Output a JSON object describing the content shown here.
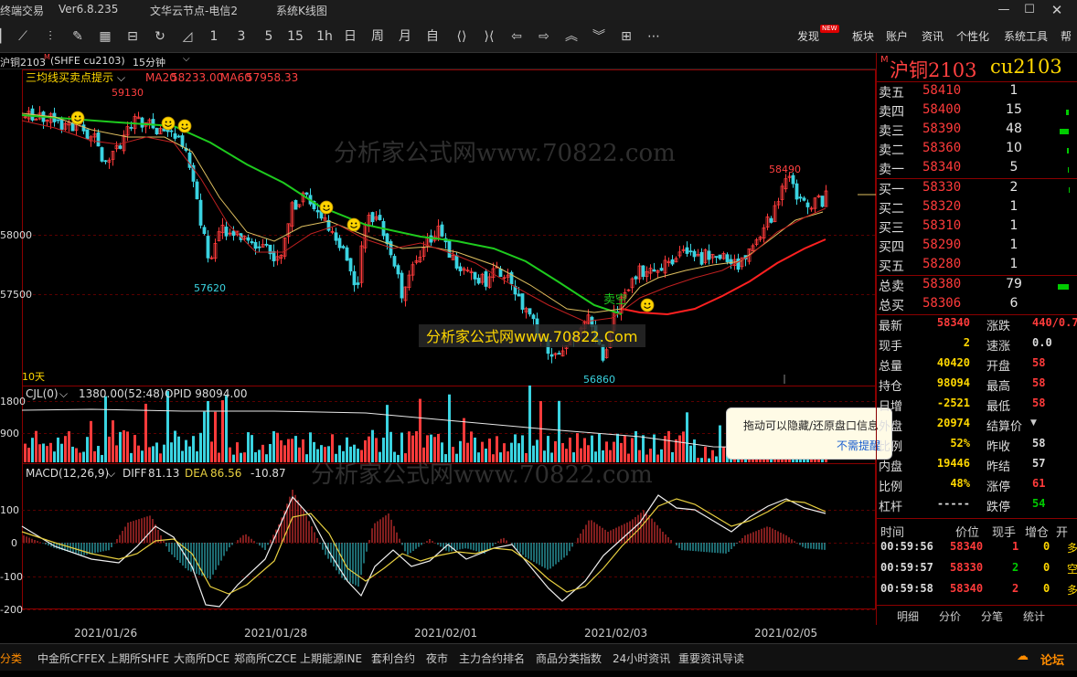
{
  "titlebar": {
    "app": "终端交易",
    "version": "Ver6.8.235",
    "server": "文华云节点-电信2",
    "mode": "系统K线图"
  },
  "toolbar": {
    "period_buttons": [
      "1",
      "3",
      "5",
      "15",
      "1h",
      "日",
      "周",
      "月",
      "自"
    ],
    "right": {
      "discover": "发现",
      "badge": "NEW",
      "sector": "板块",
      "account": "账户",
      "news": "资讯",
      "personal": "个性化",
      "tools": "系统工具",
      "more": "帮"
    }
  },
  "instrument": {
    "name": "沪铜2103",
    "mark": "M",
    "paren": "(SHFE cu2103)",
    "period": "15分钟"
  },
  "main": {
    "indicator": "三均线买卖点提示",
    "ma20_label": "MA20",
    "ma20": "58233.00",
    "ma60_label": "MA60",
    "ma60": "57958.33",
    "labels": {
      "h1": "59130",
      "h2": "58490",
      "l1": "57620",
      "l2": "56860",
      "sell": "卖空",
      "days": "10天"
    },
    "yticks": [
      "58000",
      "57500"
    ]
  },
  "volume": {
    "title": "CJL(0)",
    "value": "1380.00(52:48)",
    "opid": "OPID 98094.00",
    "yticks": [
      "1800",
      "900"
    ]
  },
  "macd": {
    "title": "MACD(12,26,9)",
    "diff_label": "DIFF",
    "diff": "81.13",
    "dea_label": "DEA",
    "dea": "86.56",
    "macd": "-10.87",
    "yticks": [
      "100",
      "0",
      "-100",
      "-200"
    ]
  },
  "dates": [
    "2021/01/26",
    "2021/01/28",
    "2021/02/01",
    "2021/02/03",
    "2021/02/05"
  ],
  "watermark": {
    "text1": "分析家公式网www.70822.com",
    "text2": "分析家公式网www.70822.Com",
    "text3": "分析家公式网www.70822.com"
  },
  "tooltip": {
    "message": "拖动可以隐藏/还原盘口信息",
    "dismiss": "不需提醒"
  },
  "quote": {
    "badge": "M",
    "name": "沪铜2103",
    "code": "cu2103",
    "asks": [
      {
        "label": "卖五",
        "price": "58410",
        "vol": "1"
      },
      {
        "label": "卖四",
        "price": "58400",
        "vol": "15"
      },
      {
        "label": "卖三",
        "price": "58390",
        "vol": "48"
      },
      {
        "label": "卖二",
        "price": "58360",
        "vol": "10"
      },
      {
        "label": "卖一",
        "price": "58340",
        "vol": "5"
      }
    ],
    "bids": [
      {
        "label": "买一",
        "price": "58330",
        "vol": "2"
      },
      {
        "label": "买二",
        "price": "58320",
        "vol": "1"
      },
      {
        "label": "买三",
        "price": "58310",
        "vol": "1"
      },
      {
        "label": "买四",
        "price": "58290",
        "vol": "1"
      },
      {
        "label": "买五",
        "price": "58280",
        "vol": "1"
      }
    ],
    "totals": [
      {
        "label": "总卖",
        "price": "58380",
        "vol": "79"
      },
      {
        "label": "总买",
        "price": "58306",
        "vol": "6"
      }
    ],
    "stats": [
      {
        "l": "最新",
        "v": "58340",
        "vc": "#ff3b3b",
        "l2": "涨跌",
        "v2": "440/0.7",
        "vc2": "#ff3b3b"
      },
      {
        "l": "现手",
        "v": "2",
        "vc": "#ffd700",
        "l2": "速涨",
        "v2": "0.0",
        "vc2": "#ddd"
      },
      {
        "l": "总量",
        "v": "40420",
        "vc": "#ffd700",
        "l2": "开盘",
        "v2": "58",
        "vc2": "#ff3b3b"
      },
      {
        "l": "持仓",
        "v": "98094",
        "vc": "#ffd700",
        "l2": "最高",
        "v2": "58",
        "vc2": "#ff3b3b"
      },
      {
        "l": "日增",
        "v": "-2521",
        "vc": "#ffd700",
        "l2": "最低",
        "v2": "58",
        "vc2": "#ff3b3b"
      },
      {
        "l": "外盘",
        "v": "20974",
        "vc": "#ffd700",
        "l2": "结算价",
        "v2": "",
        "vc2": "#ddd"
      },
      {
        "l": "比例",
        "v": "52%",
        "vc": "#ffd700",
        "l2": "昨收",
        "v2": "58",
        "vc2": "#ddd"
      },
      {
        "l": "内盘",
        "v": "19446",
        "vc": "#ffd700",
        "l2": "昨结",
        "v2": "57",
        "vc2": "#ddd"
      },
      {
        "l": "比例",
        "v": "48%",
        "vc": "#ffd700",
        "l2": "涨停",
        "v2": "61",
        "vc2": "#ff3b3b"
      },
      {
        "l": "杠杆",
        "v": "-----",
        "vc": "#ddd",
        "l2": "跌停",
        "v2": "54",
        "vc2": "#0c0"
      }
    ],
    "ticks_header": [
      "时间",
      "价位",
      "现手",
      "增仓",
      "开"
    ],
    "ticks": [
      {
        "t": "00:59:56",
        "p": "58340",
        "v": "1",
        "vc": "#ff3b3b",
        "oi": "0",
        "k": "多"
      },
      {
        "t": "00:59:57",
        "p": "58330",
        "v": "2",
        "vc": "#0c0",
        "oi": "0",
        "k": "空"
      },
      {
        "t": "00:59:58",
        "p": "58340",
        "v": "2",
        "vc": "#ff3b3b",
        "oi": "0",
        "k": "多"
      }
    ],
    "tabs": [
      "明细",
      "分价",
      "分笔",
      "统计"
    ]
  },
  "bottom": {
    "items": [
      "分类",
      "中金所CFFEX",
      "上期所SHFE",
      "大商所DCE",
      "郑商所CZCE",
      "上期能源INE",
      "套利合约",
      "夜市",
      "主力合约排名",
      "商品分类指数",
      "24小时资讯",
      "重要资讯导读"
    ],
    "forum": "论坛"
  }
}
